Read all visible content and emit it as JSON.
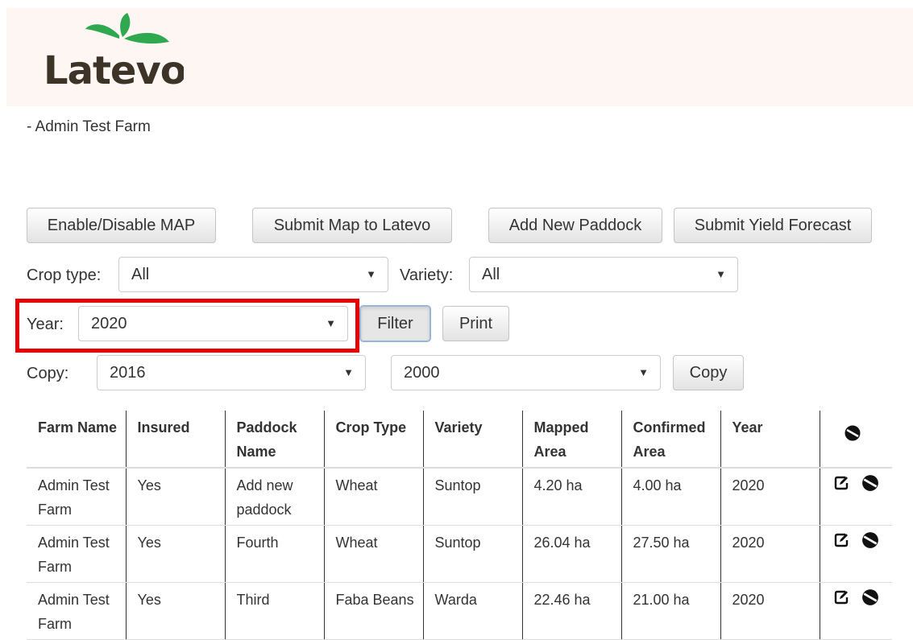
{
  "brand": {
    "logo_text": "Latevo",
    "leaf_color": "#2fa84f",
    "text_color": "#3d3427"
  },
  "farm_subtitle": "- Admin Test Farm",
  "toolbar": {
    "enable_map": "Enable/Disable MAP",
    "submit_map": "Submit Map to Latevo",
    "add_paddock": "Add New Paddock",
    "submit_yield": "Submit Yield Forecast"
  },
  "filters": {
    "crop_type_label": "Crop type:",
    "crop_type_value": "All",
    "variety_label": "Variety:",
    "variety_value": "All",
    "year_label": "Year:",
    "year_value": "2020",
    "filter_button": "Filter",
    "print_button": "Print",
    "copy_label": "Copy:",
    "copy_from": "2016",
    "copy_to": "2000",
    "copy_button": "Copy"
  },
  "highlight_color": "#e60000",
  "table": {
    "headers": [
      {
        "line1": "Farm Name",
        "line2": ""
      },
      {
        "line1": "Insured",
        "line2": ""
      },
      {
        "line1": "Paddock",
        "line2": "Name"
      },
      {
        "line1": "Crop Type",
        "line2": ""
      },
      {
        "line1": "Variety",
        "line2": ""
      },
      {
        "line1": "Mapped",
        "line2": "Area"
      },
      {
        "line1": "Confirmed",
        "line2": "Area"
      },
      {
        "line1": "Year",
        "line2": ""
      }
    ],
    "header_action_icon": "delete-disabled-icon",
    "rows": [
      {
        "farm_name": "Admin Test Farm",
        "insured": "Yes",
        "paddock": "Add new paddock",
        "crop": "Wheat",
        "variety": "Suntop",
        "mapped": "4.20 ha",
        "confirmed": "4.00 ha",
        "year": "2020"
      },
      {
        "farm_name": "Admin Test Farm",
        "insured": "Yes",
        "paddock": "Fourth",
        "crop": "Wheat",
        "variety": "Suntop",
        "mapped": "26.04 ha",
        "confirmed": "27.50 ha",
        "year": "2020"
      },
      {
        "farm_name": "Admin Test Farm",
        "insured": "Yes",
        "paddock": "Third",
        "crop": "Faba Beans",
        "variety": "Warda",
        "mapped": "22.46 ha",
        "confirmed": "21.00 ha",
        "year": "2020"
      }
    ],
    "row_icons": [
      "edit-icon",
      "delete-icon"
    ]
  }
}
